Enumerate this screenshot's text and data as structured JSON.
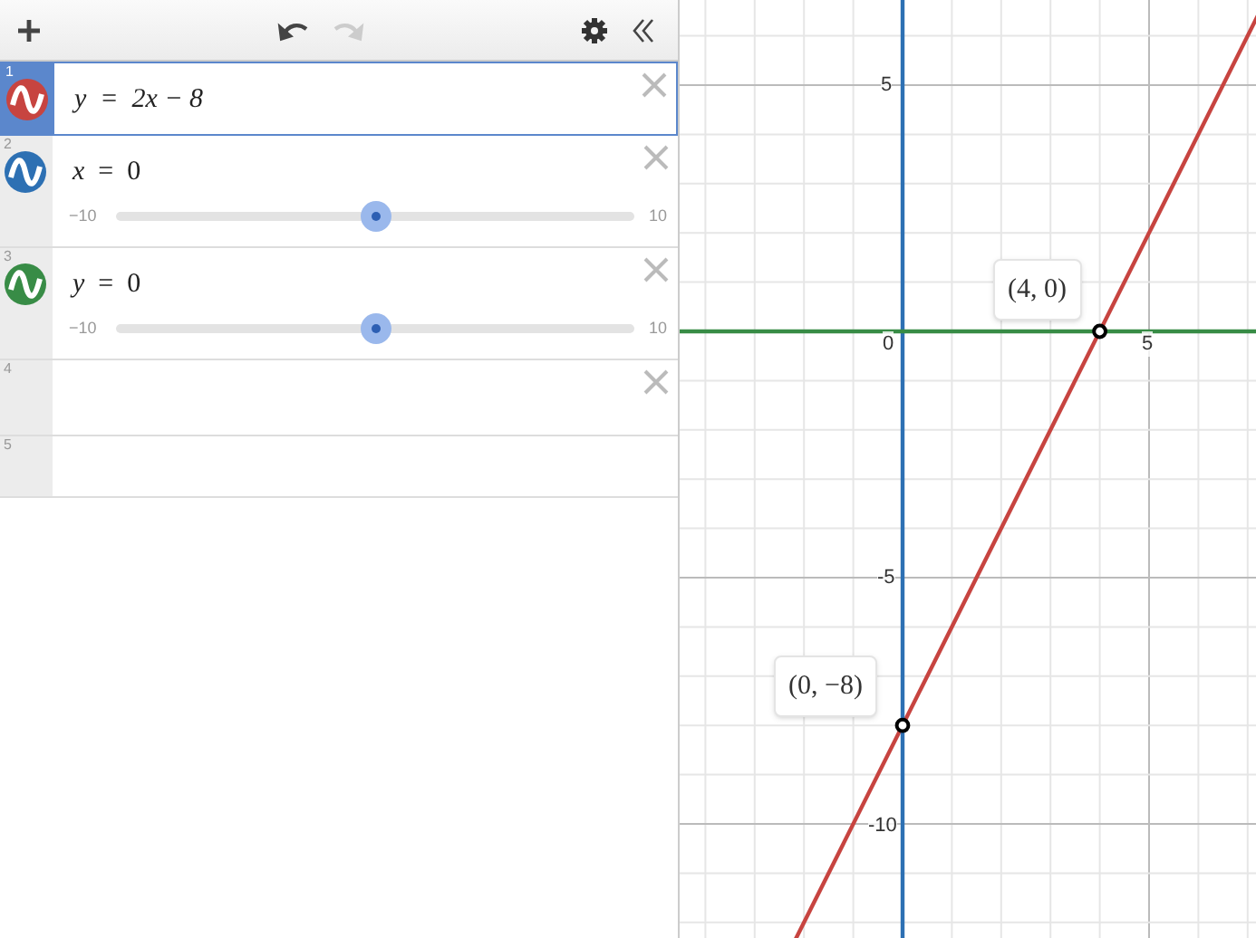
{
  "toolbar": {
    "undo_disabled": false,
    "redo_disabled": true
  },
  "expressions": [
    {
      "index": "1",
      "selected": true,
      "kind": "equation",
      "color": "#c74440",
      "text": "y = 2x − 8",
      "removable": true
    },
    {
      "index": "2",
      "selected": false,
      "kind": "slider",
      "color": "#2d70b3",
      "text": "*x* = 0",
      "slider": {
        "min": "−10",
        "max": "10",
        "level": 0.5
      },
      "removable": true
    },
    {
      "index": "3",
      "selected": false,
      "kind": "slider",
      "color": "#388c46",
      "text": "*y* = 0",
      "slider": {
        "min": "−10",
        "max": "10",
        "level": 0.5
      },
      "removable": true
    },
    {
      "index": "4",
      "selected": false,
      "kind": "empty",
      "removable": true
    },
    {
      "index": "5",
      "selected": false,
      "kind": "empty",
      "removable": false
    }
  ],
  "graph": {
    "x_tick_labels": [
      "0",
      "5"
    ],
    "y_tick_labels": [
      "5",
      "-5",
      "-10"
    ],
    "point_labels": [
      "(4, 0)",
      "(0, −8)"
    ]
  }
}
